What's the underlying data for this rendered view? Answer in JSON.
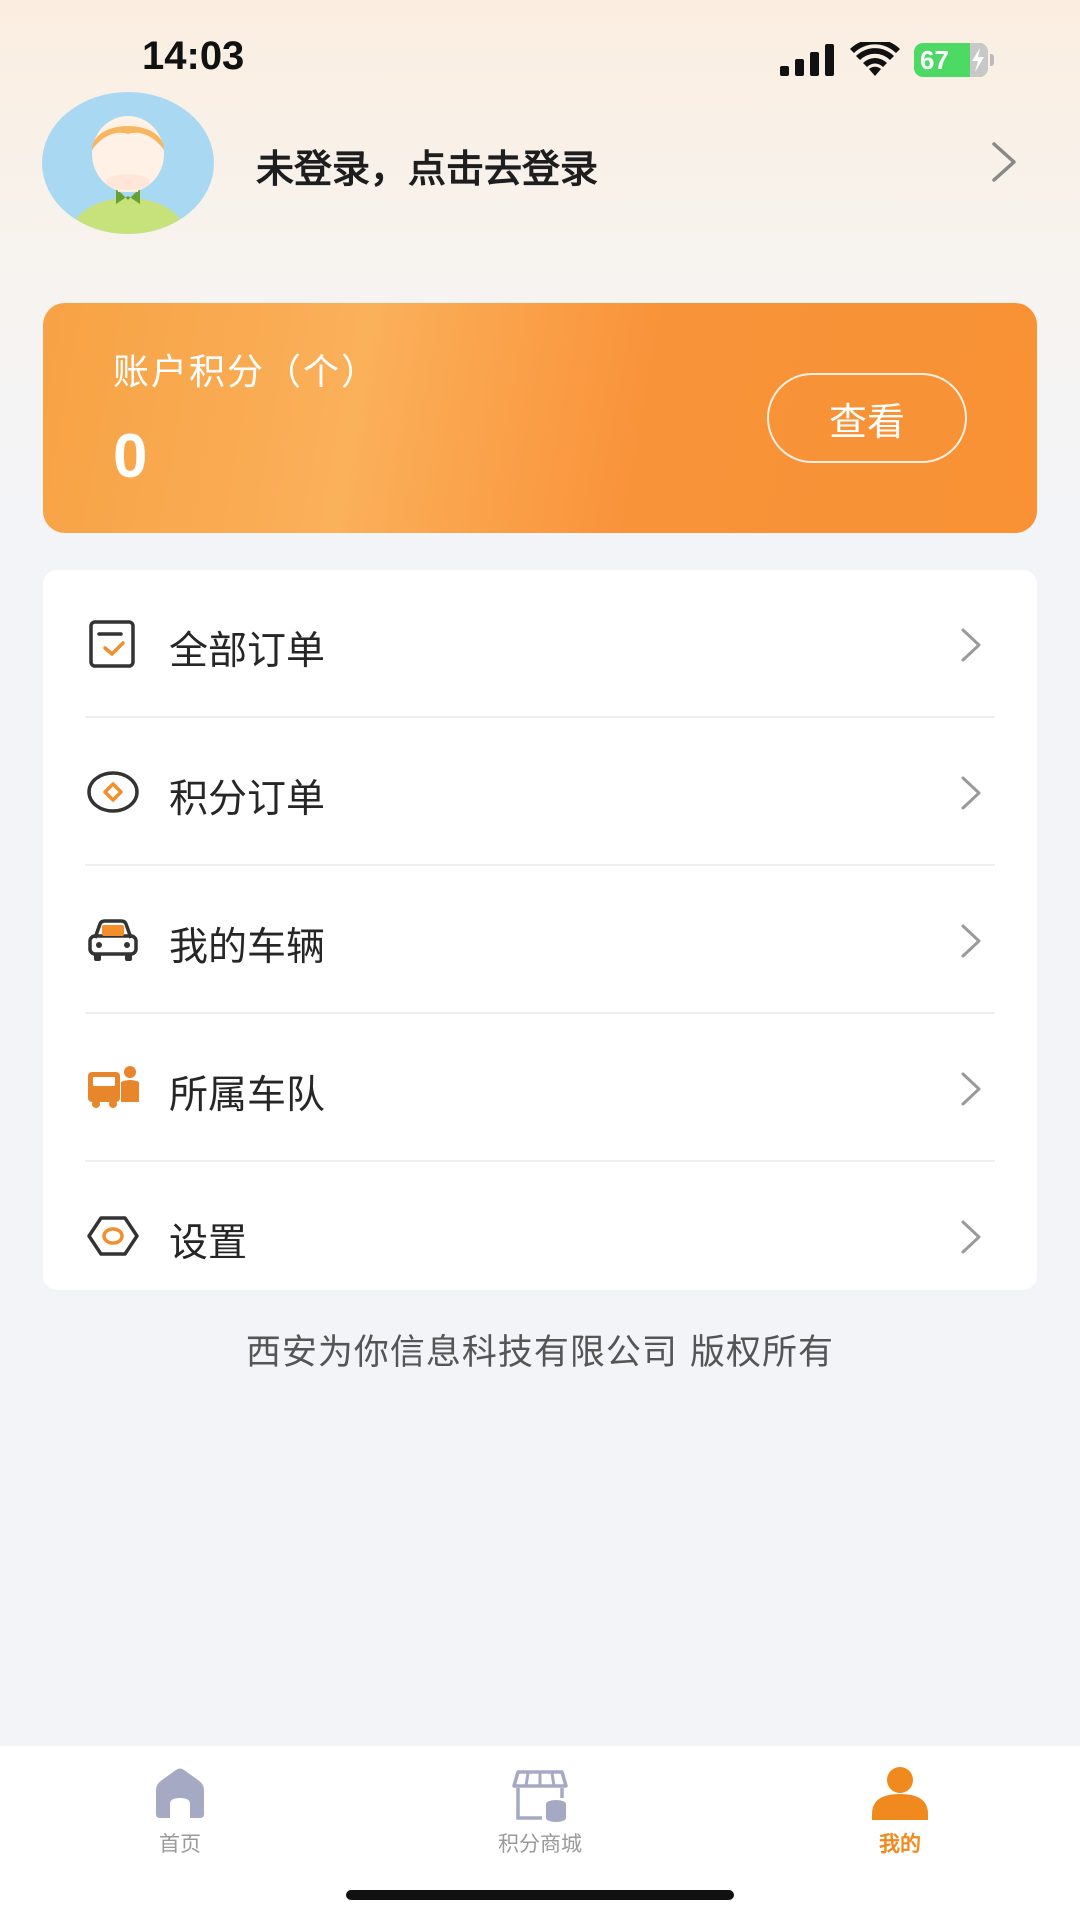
{
  "status_bar": {
    "time": "14:03",
    "battery_level": "67",
    "icons": [
      "signal-icon",
      "wifi-icon",
      "battery-charging-icon"
    ]
  },
  "profile": {
    "login_prompt": "未登录，点击去登录"
  },
  "points_card": {
    "label": "账户积分（个）",
    "value": "0",
    "view_button": "查看"
  },
  "menu": {
    "items": [
      {
        "label": "全部订单",
        "icon": "orders-icon"
      },
      {
        "label": "积分订单",
        "icon": "points-order-icon"
      },
      {
        "label": "我的车辆",
        "icon": "car-icon"
      },
      {
        "label": "所属车队",
        "icon": "fleet-icon"
      },
      {
        "label": "设置",
        "icon": "settings-icon"
      }
    ]
  },
  "footer": {
    "copyright": "西安为你信息科技有限公司 版权所有"
  },
  "tab_bar": {
    "tabs": [
      {
        "label": "首页",
        "icon": "home-icon",
        "active": false
      },
      {
        "label": "积分商城",
        "icon": "store-icon",
        "active": false
      },
      {
        "label": "我的",
        "icon": "profile-icon",
        "active": true
      }
    ]
  },
  "colors": {
    "accent": "#f89234",
    "active_tab": "#f08a1e",
    "inactive_tab": "#9a9a9a"
  }
}
